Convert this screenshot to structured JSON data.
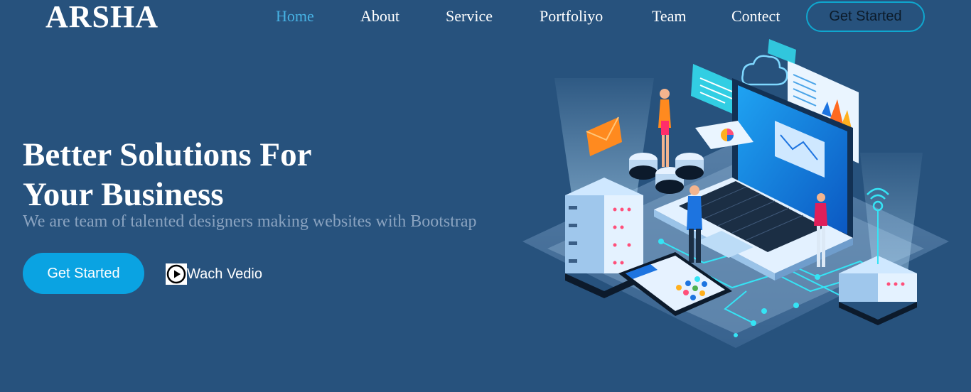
{
  "brand": {
    "logo": "ARSHA"
  },
  "nav": {
    "items": [
      {
        "label": "Home",
        "active": true
      },
      {
        "label": "About"
      },
      {
        "label": "Service"
      },
      {
        "label": "Portfoliyo"
      },
      {
        "label": "Team"
      },
      {
        "label": "Contect"
      }
    ],
    "cta_label": "Get Started"
  },
  "hero": {
    "title_line1": "Better Solutions For",
    "title_line2": "Your Business",
    "subtitle": "We are team of talented designers making websites with Bootstrap",
    "primary_button": "Get Started",
    "video_link": "Wach Vedio"
  },
  "colors": {
    "background": "#27527d",
    "accent": "#47b2e4",
    "button": "#0aa3e2",
    "subtitle": "#8aa3c0"
  },
  "icons": [
    "play-icon"
  ]
}
